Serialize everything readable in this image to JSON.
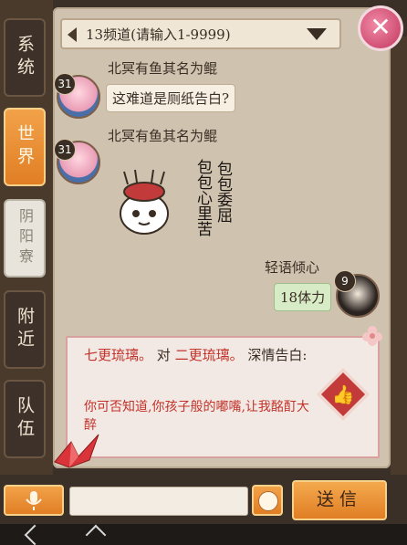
{
  "rail": {
    "tabs": [
      {
        "label": "系统",
        "state": "normal"
      },
      {
        "label": "世界",
        "state": "active"
      },
      {
        "label": "阴阳寮",
        "state": "disabled"
      },
      {
        "label": "附近",
        "state": "normal"
      },
      {
        "label": "队伍",
        "state": "normal"
      }
    ]
  },
  "channel": {
    "label": "13频道(请输入1-9999)"
  },
  "close": {
    "glyph": "✕",
    "icon": "close-icon"
  },
  "messages": [
    {
      "level": "31",
      "name": "北冥有鱼其名为鲲",
      "text": "这难道是厕纸告白?"
    },
    {
      "level": "31",
      "name": "北冥有鱼其名为鲲",
      "sticker_text_1": "包包心里苦",
      "sticker_text_2": "包包委屈"
    },
    {
      "level": "9",
      "name": "轻语倾心",
      "text": "18体力"
    }
  ],
  "confession": {
    "from": "七更琉璃。",
    "mid": "对",
    "to": "二更琉璃。",
    "tail": "深情告白:",
    "line": "你可否知道,你孩子般的嘟嘴,让我酩酊大醉",
    "icon": "thumbs-up-icon"
  },
  "bottom": {
    "input_value": "",
    "send_label": "送信",
    "mic_icon": "microphone-icon",
    "emoji_icon": "emoji-face-icon"
  },
  "colors": {
    "active_tab": "#e07e24",
    "panel": "#cfc3b0",
    "red_text": "#c2322a"
  }
}
